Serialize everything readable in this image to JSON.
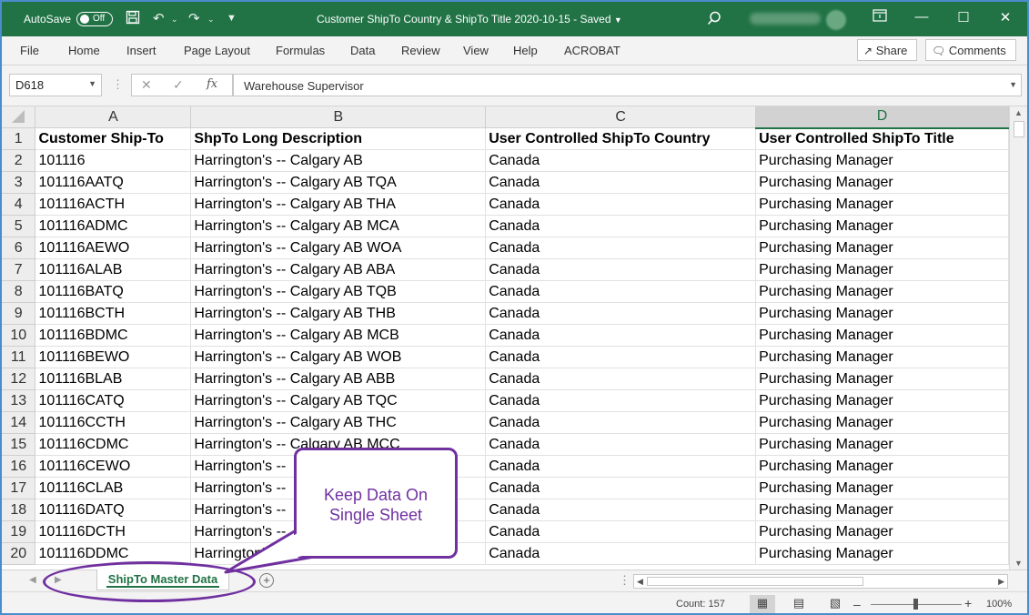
{
  "titlebar": {
    "autosave_label": "AutoSave",
    "autosave_state": "Off",
    "document_title": "Customer ShipTo Country & ShipTo Title 2020-10-15  -  Saved",
    "user_name": "Karen Fenelly"
  },
  "ribbon": {
    "tabs": [
      "File",
      "Home",
      "Insert",
      "Page Layout",
      "Formulas",
      "Data",
      "Review",
      "View",
      "Help",
      "ACROBAT"
    ],
    "share_label": "Share",
    "comments_label": "Comments"
  },
  "formula_bar": {
    "name_box": "D618",
    "fx_label": "fx",
    "value": "Warehouse Supervisor"
  },
  "grid": {
    "columns": [
      "A",
      "B",
      "C",
      "D"
    ],
    "selected_column": "D",
    "rows": [
      {
        "n": "1",
        "a": "Customer Ship-To",
        "b": "ShpTo Long Description",
        "c": "User Controlled ShipTo Country",
        "d": "User Controlled ShipTo Title"
      },
      {
        "n": "2",
        "a": "101116",
        "b": "Harrington's -- Calgary AB",
        "c": "Canada",
        "d": "Purchasing Manager"
      },
      {
        "n": "3",
        "a": "101116AATQ",
        "b": "Harrington's -- Calgary AB TQA",
        "c": "Canada",
        "d": "Purchasing Manager"
      },
      {
        "n": "4",
        "a": "101116ACTH",
        "b": "Harrington's -- Calgary AB THA",
        "c": "Canada",
        "d": "Purchasing Manager"
      },
      {
        "n": "5",
        "a": "101116ADMC",
        "b": "Harrington's -- Calgary AB MCA",
        "c": "Canada",
        "d": "Purchasing Manager"
      },
      {
        "n": "6",
        "a": "101116AEWO",
        "b": "Harrington's -- Calgary AB WOA",
        "c": "Canada",
        "d": "Purchasing Manager"
      },
      {
        "n": "7",
        "a": "101116ALAB",
        "b": "Harrington's -- Calgary AB ABA",
        "c": "Canada",
        "d": "Purchasing Manager"
      },
      {
        "n": "8",
        "a": "101116BATQ",
        "b": "Harrington's -- Calgary AB TQB",
        "c": "Canada",
        "d": "Purchasing Manager"
      },
      {
        "n": "9",
        "a": "101116BCTH",
        "b": "Harrington's -- Calgary AB THB",
        "c": "Canada",
        "d": "Purchasing Manager"
      },
      {
        "n": "10",
        "a": "101116BDMC",
        "b": "Harrington's -- Calgary AB MCB",
        "c": "Canada",
        "d": "Purchasing Manager"
      },
      {
        "n": "11",
        "a": "101116BEWO",
        "b": "Harrington's -- Calgary AB WOB",
        "c": "Canada",
        "d": "Purchasing Manager"
      },
      {
        "n": "12",
        "a": "101116BLAB",
        "b": "Harrington's -- Calgary AB ABB",
        "c": "Canada",
        "d": "Purchasing Manager"
      },
      {
        "n": "13",
        "a": "101116CATQ",
        "b": "Harrington's -- Calgary AB TQC",
        "c": "Canada",
        "d": "Purchasing Manager"
      },
      {
        "n": "14",
        "a": "101116CCTH",
        "b": "Harrington's -- Calgary AB THC",
        "c": "Canada",
        "d": "Purchasing Manager"
      },
      {
        "n": "15",
        "a": "101116CDMC",
        "b": "Harrington's -- Calgary AB MCC",
        "c": "Canada",
        "d": "Purchasing Manager"
      },
      {
        "n": "16",
        "a": "101116CEWO",
        "b": "Harrington's -- ",
        "c": "Canada",
        "d": "Purchasing Manager"
      },
      {
        "n": "17",
        "a": "101116CLAB",
        "b": "Harrington's -- ",
        "c": "Canada",
        "d": "Purchasing Manager"
      },
      {
        "n": "18",
        "a": "101116DATQ",
        "b": "Harrington's -- ",
        "c": "Canada",
        "d": "Purchasing Manager"
      },
      {
        "n": "19",
        "a": "101116DCTH",
        "b": "Harrington's -- ",
        "c": "Canada",
        "d": "Purchasing Manager"
      },
      {
        "n": "20",
        "a": "101116DDMC",
        "b": "Harrington's -- ",
        "c": "Canada",
        "d": "Purchasing Manager"
      }
    ]
  },
  "sheet_tabs": {
    "active": "ShipTo Master Data"
  },
  "status": {
    "count": "Count: 157",
    "zoom": "100%"
  },
  "callout": {
    "line1": "Keep Data On",
    "line2": "Single Sheet",
    "color": "#7030a0"
  },
  "colors": {
    "excel_green": "#217346",
    "frame_border": "#4a8ccc"
  }
}
